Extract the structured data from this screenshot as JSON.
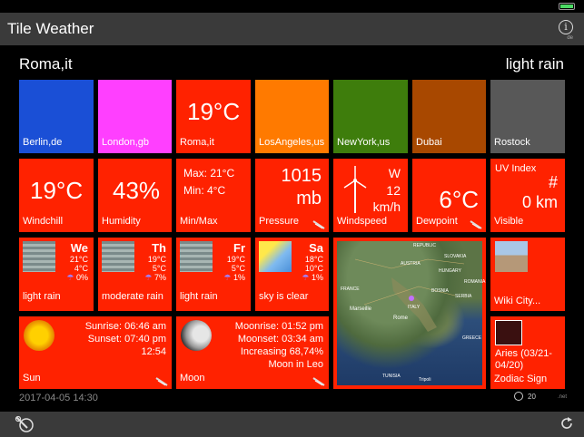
{
  "app": {
    "title": "Tile Weather",
    "info_sub": "de"
  },
  "header": {
    "city": "Roma,it",
    "condition": "light rain"
  },
  "cities": [
    {
      "name": "Berlin,de",
      "color": "#1a4fd6"
    },
    {
      "name": "London,gb",
      "color": "#ff3fff"
    },
    {
      "name": "Roma,it",
      "color": "#ff2200",
      "temp": "19°C"
    },
    {
      "name": "LosAngeles,us",
      "color": "#ff7a00"
    },
    {
      "name": "NewYork,us",
      "color": "#3e7d0c"
    },
    {
      "name": "Dubai",
      "color": "#a84800"
    },
    {
      "name": "Rostock",
      "color": "#585858"
    }
  ],
  "tiles": {
    "windchill": {
      "value": "19°C",
      "label": "Windchill"
    },
    "humidity": {
      "value": "43%",
      "label": "Humidity"
    },
    "minmax": {
      "max": "Max: 21°C",
      "min": "Min: 4°C",
      "label": "Min/Max"
    },
    "pressure": {
      "value": "1015",
      "unit": "mb",
      "label": "Pressure"
    },
    "wind": {
      "dir": "W",
      "speed": "12",
      "unit": "km/h",
      "label": "Windspeed"
    },
    "dewpoint": {
      "value": "6°C",
      "label": "Dewpoint"
    },
    "uv": {
      "title": "UV Index",
      "value": "#",
      "visibility": "0 km",
      "label": "Visible"
    }
  },
  "forecast": [
    {
      "day": "We",
      "hi": "21°C",
      "lo": "4°C",
      "pop": "0%",
      "desc": "light rain",
      "icon": "rain-icon"
    },
    {
      "day": "Th",
      "hi": "19°C",
      "lo": "5°C",
      "pop": "7%",
      "desc": "moderate rain",
      "icon": "rain-icon"
    },
    {
      "day": "Fr",
      "hi": "19°C",
      "lo": "5°C",
      "pop": "1%",
      "desc": "light rain",
      "icon": "rain-icon"
    },
    {
      "day": "Sa",
      "hi": "18°C",
      "lo": "10°C",
      "pop": "1%",
      "desc": "sky is clear",
      "icon": "sun-icon"
    }
  ],
  "map": {
    "labels": [
      "REPUBLIC",
      "SLOVAKIA",
      "AUSTRIA",
      "HUNGARY",
      "ROMANIA",
      "SERBIA",
      "FRANCE",
      "Marseille",
      "Rome",
      "ITALY",
      "GREECE",
      "TUNISIA",
      "Tripoli",
      "BOSNIA"
    ]
  },
  "wiki": {
    "label": "Wiki City..."
  },
  "sun": {
    "sunrise": "Sunrise: 06:46 am",
    "sunset": "Sunset: 07:40 pm",
    "daylength": "12:54",
    "label": "Sun"
  },
  "moon": {
    "moonrise": "Moonrise: 01:52 pm",
    "moonset": "Moonset: 03:34 am",
    "phase": "Increasing  68,74%",
    "sign": "Moon in Leo",
    "label": "Moon"
  },
  "zodiac": {
    "sign": "Aries (03/21-04/20)",
    "label": "Zodiac Sign"
  },
  "footer": {
    "timestamp": "2017-04-05 14:30",
    "refresh": "20",
    "net": ".net"
  }
}
